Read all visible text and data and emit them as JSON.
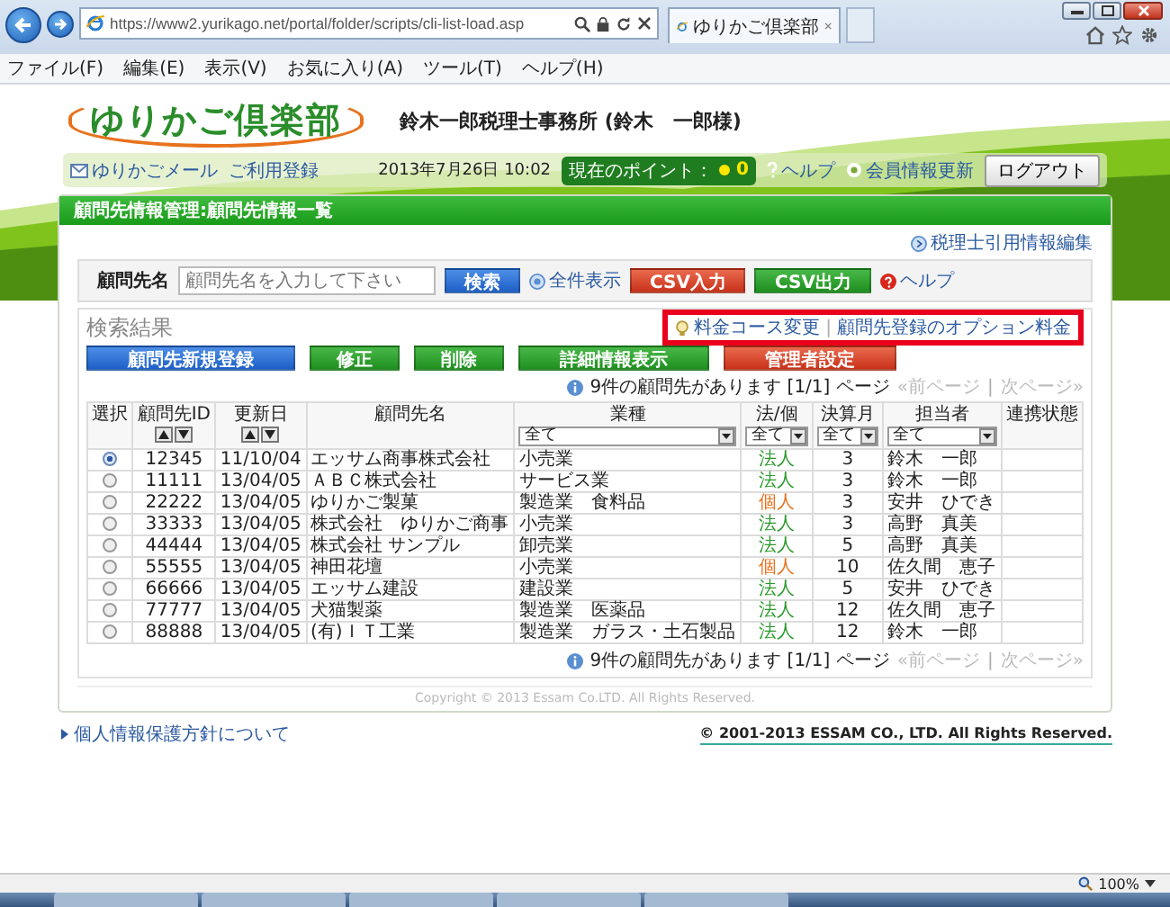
{
  "browser": {
    "url": "https://www2.yurikago.net/portal/folder/scripts/cli-list-load.asp",
    "tab_title": "ゆりかご倶楽部",
    "menu": [
      "ファイル(F)",
      "編集(E)",
      "表示(V)",
      "お気に入り(A)",
      "ツール(T)",
      "ヘルプ(H)"
    ],
    "zoom": "100%"
  },
  "header": {
    "logo": "ゆりかご倶楽部",
    "office": "鈴木一郎税理士事務所 (鈴木　一郎様)"
  },
  "nav": {
    "links": [
      "ゆりかごメール",
      "ご利用登録"
    ],
    "datetime": "2013年7月26日 10:02",
    "points_label": "現在のポイント：",
    "points": "0",
    "help": "ヘルプ",
    "update": "会員情報更新",
    "logout": "ログアウト"
  },
  "panel": {
    "title": "顧問先情報管理:顧問先情報一覧",
    "edit_link": "税理士引用情報編集",
    "search": {
      "label": "顧問先名",
      "placeholder": "顧問先名を入力して下さい",
      "items": [
        {
          "label": "検索",
          "kind": "primary"
        },
        {
          "label": "全件表示",
          "kind": "link"
        },
        {
          "label": "CSV入力",
          "kind": "danger"
        },
        {
          "label": "CSV出力",
          "kind": "success"
        },
        {
          "label": "ヘルプ",
          "kind": "help"
        }
      ]
    },
    "results": {
      "title": "検索結果",
      "links": [
        "料金コース変更",
        "顧問先登録のオプション料金"
      ],
      "separator": "|",
      "highlighted": true,
      "actions": [
        {
          "label": "顧問先新規登録",
          "kind": "primary"
        },
        {
          "label": "修正",
          "kind": "success"
        },
        {
          "label": "削除",
          "kind": "success"
        },
        {
          "label": "詳細情報表示",
          "kind": "success"
        },
        {
          "label": "管理者設定",
          "kind": "danger"
        }
      ]
    },
    "pager_top": {
      "count": "9件の顧問先があります [1/1] ページ",
      "prev": "«前ページ",
      "separator": "|",
      "next": "次ページ»",
      "disabled": true
    },
    "table": {
      "columns": [
        {
          "label": "選択"
        },
        {
          "label": "顧問先ID",
          "sortable": true
        },
        {
          "label": "更新日",
          "sortable": true
        },
        {
          "label": "顧問先名"
        },
        {
          "label": "業種",
          "filter": "全て"
        },
        {
          "label": "法/個",
          "filter": "全て"
        },
        {
          "label": "決算月",
          "filter": "全て"
        },
        {
          "label": "担当者",
          "filter": "全て"
        },
        {
          "label": "連携状態"
        }
      ],
      "rows": [
        {
          "selected": true,
          "id": "12345",
          "updated": "11/10/04",
          "name": "エッサム商事株式会社",
          "industry": "小売業",
          "entity": "法人",
          "color": "#2a9a2a",
          "month": "3",
          "staff": "鈴木　一郎"
        },
        {
          "selected": false,
          "id": "11111",
          "updated": "13/04/05",
          "name": "ＡＢＣ株式会社",
          "industry": "サービス業",
          "entity": "法人",
          "color": "#2a9a2a",
          "month": "3",
          "staff": "鈴木　一郎"
        },
        {
          "selected": false,
          "id": "22222",
          "updated": "13/04/05",
          "name": "ゆりかご製菓",
          "industry": "製造業　食料品",
          "entity": "個人",
          "color": "#e7721d",
          "month": "3",
          "staff": "安井　ひでき"
        },
        {
          "selected": false,
          "id": "33333",
          "updated": "13/04/05",
          "name": "株式会社　ゆりかご商事",
          "industry": "小売業",
          "entity": "法人",
          "color": "#2a9a2a",
          "month": "3",
          "staff": "高野　真美"
        },
        {
          "selected": false,
          "id": "44444",
          "updated": "13/04/05",
          "name": "株式会社 サンプル",
          "industry": "卸売業",
          "entity": "法人",
          "color": "#2a9a2a",
          "month": "5",
          "staff": "高野　真美"
        },
        {
          "selected": false,
          "id": "55555",
          "updated": "13/04/05",
          "name": "神田花壇",
          "industry": "小売業",
          "entity": "個人",
          "color": "#e7721d",
          "month": "10",
          "staff": "佐久間　恵子"
        },
        {
          "selected": false,
          "id": "66666",
          "updated": "13/04/05",
          "name": "エッサム建設",
          "industry": "建設業",
          "entity": "法人",
          "color": "#2a9a2a",
          "month": "5",
          "staff": "安井　ひでき"
        },
        {
          "selected": false,
          "id": "77777",
          "updated": "13/04/05",
          "name": "犬猫製薬",
          "industry": "製造業　医薬品",
          "entity": "法人",
          "color": "#2a9a2a",
          "month": "12",
          "staff": "佐久間　恵子"
        },
        {
          "selected": false,
          "id": "88888",
          "updated": "13/04/05",
          "name": "(有)ＩＴ工業",
          "industry": "製造業　ガラス・土石製品",
          "entity": "法人",
          "color": "#2a9a2a",
          "month": "12",
          "staff": "鈴木　一郎"
        }
      ]
    },
    "pager_bottom": {
      "count": "9件の顧問先があります [1/1] ページ",
      "prev": "«前ページ",
      "separator": "|",
      "next": "次ページ»",
      "disabled": true
    },
    "copyright": "Copyright © 2013 Essam Co.LTD. All Rights Reserved."
  },
  "footer": {
    "privacy": "個人情報保護方針について",
    "copyright": "© 2001-2013 ESSAM CO., LTD. All Rights Reserved."
  }
}
